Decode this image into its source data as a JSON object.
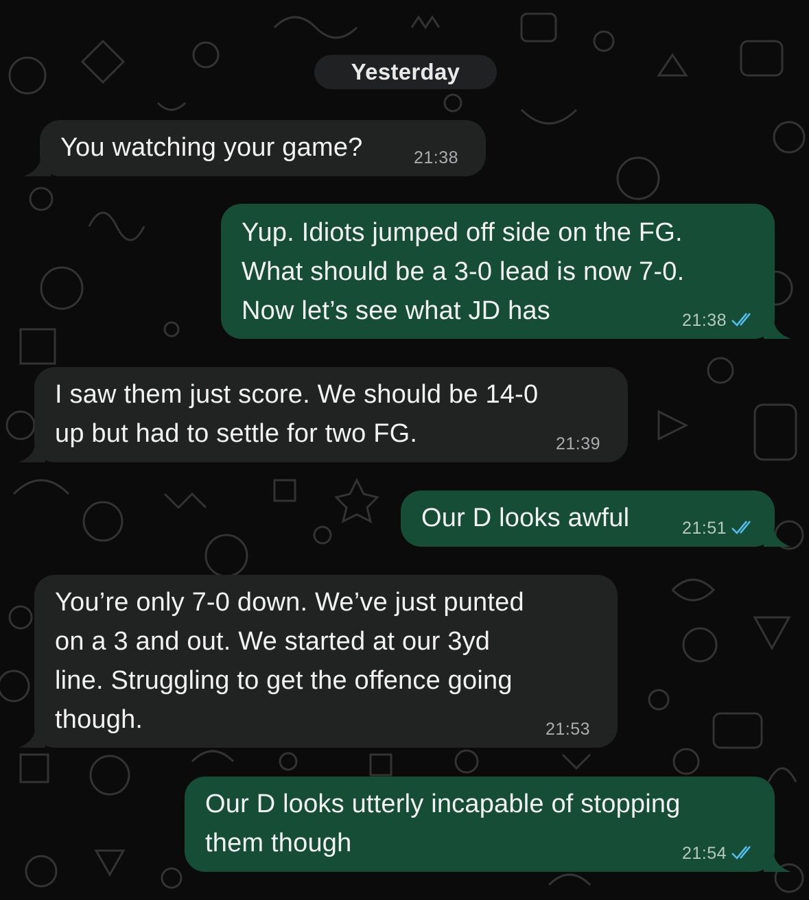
{
  "date_separator": "Yesterday",
  "messages": [
    {
      "direction": "in",
      "lines": [
        "You watching your game?"
      ],
      "time": "21:38"
    },
    {
      "direction": "out",
      "lines": [
        "Yup. Idiots jumped off side on the FG.",
        "What should be a 3-0 lead is now 7-0.",
        "Now let’s see what JD has"
      ],
      "time": "21:38",
      "status": "read"
    },
    {
      "direction": "in",
      "lines": [
        "I saw them just score. We should be 14-0",
        "up but had to settle for two FG."
      ],
      "time": "21:39"
    },
    {
      "direction": "out",
      "lines": [
        "Our D looks awful"
      ],
      "time": "21:51",
      "status": "read"
    },
    {
      "direction": "in",
      "lines": [
        "You’re only 7-0 down. We’ve just punted",
        "on a 3 and out. We started at our 3yd",
        "line. Struggling to get the offence going",
        "though."
      ],
      "time": "21:53"
    },
    {
      "direction": "out",
      "lines": [
        "Our D looks utterly incapable of stopping",
        "them though"
      ],
      "time": "21:54",
      "status": "read"
    }
  ],
  "colors": {
    "background": "#0b0b0b",
    "incoming_bubble": "#212323",
    "outgoing_bubble": "#154d37",
    "read_ticks": "#53bdeb",
    "timestamp": "#a9acad"
  },
  "icons": {
    "read_receipt": "double-check-icon",
    "wallpaper": "doodle-pattern"
  }
}
